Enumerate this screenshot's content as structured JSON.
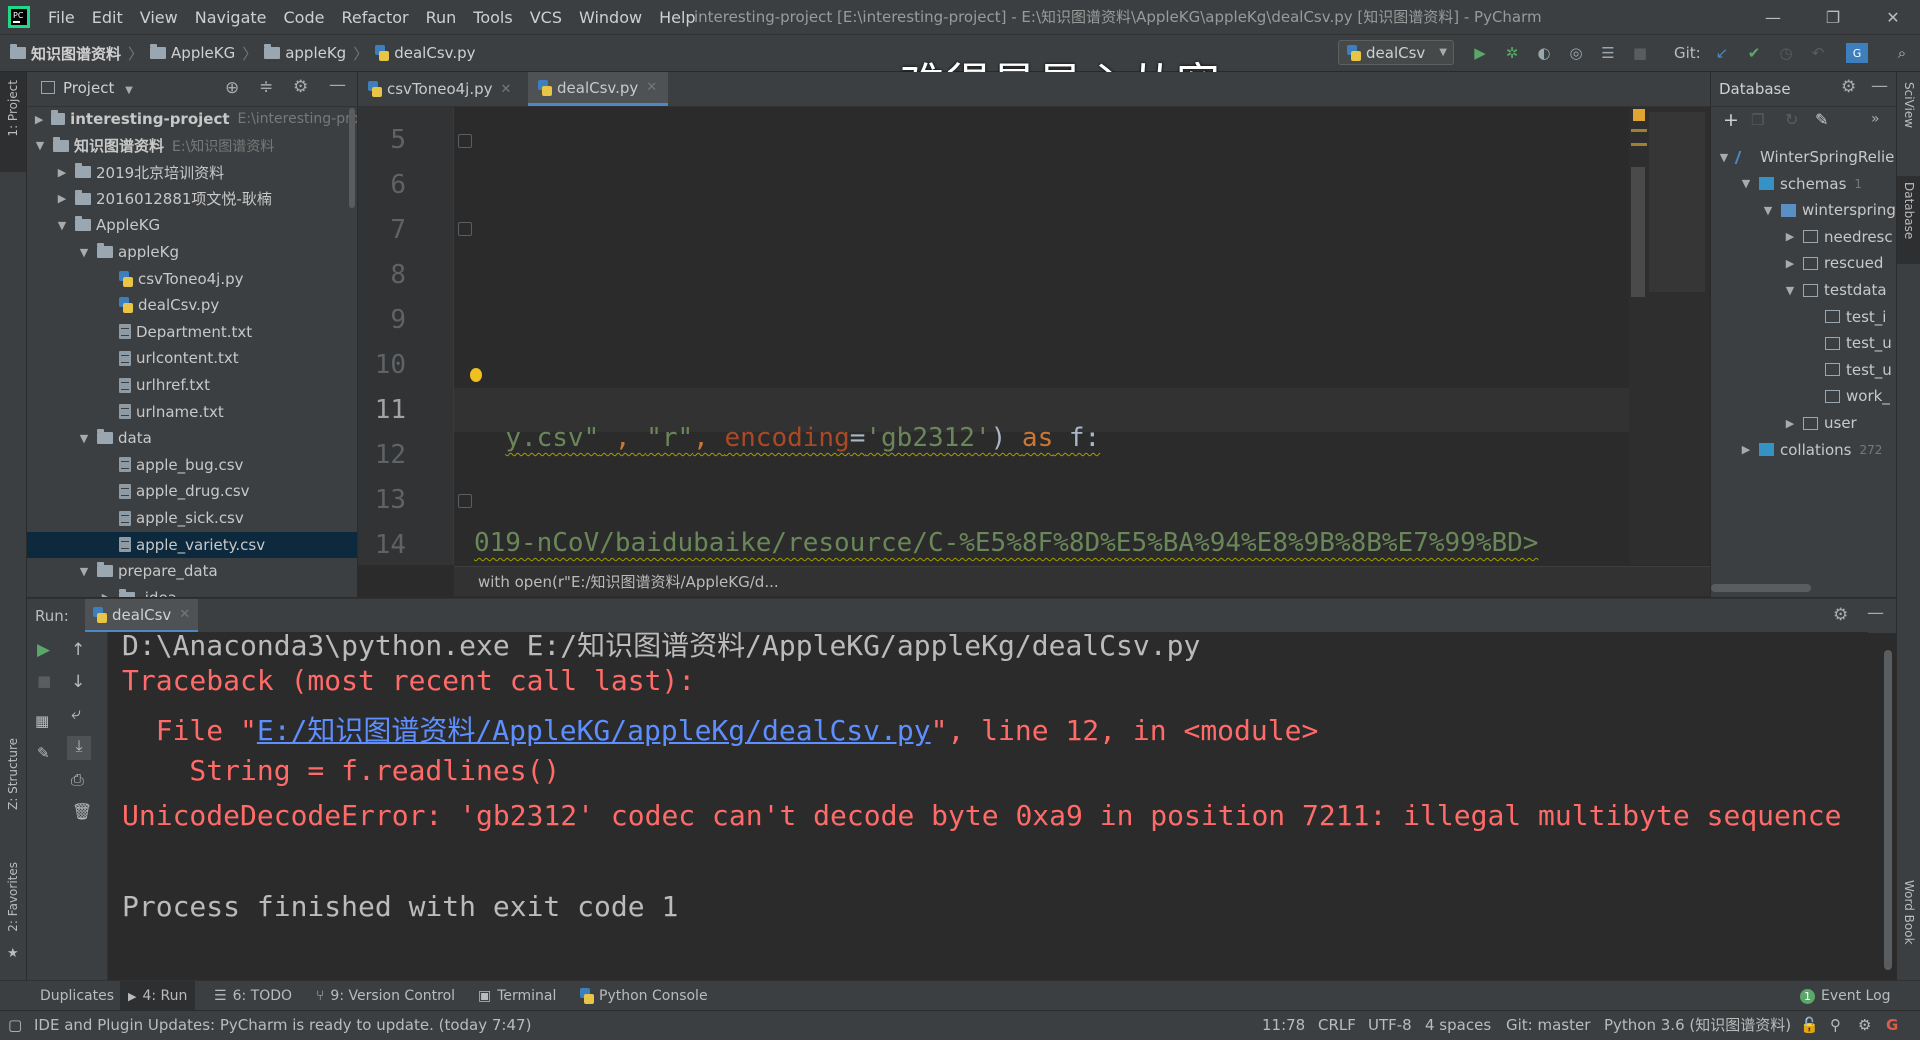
{
  "menubar": {
    "items": [
      "File",
      "Edit",
      "View",
      "Navigate",
      "Code",
      "Refactor",
      "Run",
      "Tools",
      "VCS",
      "Window",
      "Help"
    ],
    "window_title": "interesting-project [E:\\interesting-project] - E:\\知识图谱资料\\AppleKG\\appleKg\\dealCsv.py [知识图谱资料] - PyCharm"
  },
  "navbar": {
    "crumbs": [
      "知识图谱资料",
      "AppleKG",
      "appleKg",
      "dealCsv.py"
    ],
    "run_config": "dealCsv",
    "git_label": "Git:"
  },
  "caption": "难得最是心从容",
  "left_strip": {
    "project": "1: Project",
    "structure": "Z: Structure",
    "favorites": "2: Favorites"
  },
  "right_strip": {
    "sciview": "SciView",
    "database": "Database",
    "wordbook": "Word Book"
  },
  "project_panel": {
    "title": "Project",
    "tree": [
      {
        "label": "interesting-project",
        "extra": "E:\\interesting-proj",
        "type": "folder",
        "expanded": false,
        "bold": true
      },
      {
        "label": "知识图谱资料",
        "extra": "E:\\知识图谱资料",
        "type": "folder",
        "expanded": true,
        "bold": true
      },
      {
        "label": "2019北京培训资料",
        "extra": "",
        "type": "folder",
        "expanded": false
      },
      {
        "label": "2016012881项文悦-耿楠",
        "extra": "",
        "type": "folder",
        "expanded": false
      },
      {
        "label": "AppleKG",
        "extra": "",
        "type": "folder",
        "expanded": true
      },
      {
        "label": "appleKg",
        "extra": "",
        "type": "folder",
        "expanded": true
      },
      {
        "label": "csvToneo4j.py",
        "extra": "",
        "type": "py"
      },
      {
        "label": "dealCsv.py",
        "extra": "",
        "type": "py"
      },
      {
        "label": "Department.txt",
        "extra": "",
        "type": "txt"
      },
      {
        "label": "urlcontent.txt",
        "extra": "",
        "type": "txt"
      },
      {
        "label": "urlhref.txt",
        "extra": "",
        "type": "txt"
      },
      {
        "label": "urlname.txt",
        "extra": "",
        "type": "txt"
      },
      {
        "label": "data",
        "extra": "",
        "type": "folder",
        "expanded": true
      },
      {
        "label": "apple_bug.csv",
        "extra": "",
        "type": "txt"
      },
      {
        "label": "apple_drug.csv",
        "extra": "",
        "type": "txt"
      },
      {
        "label": "apple_sick.csv",
        "extra": "",
        "type": "txt"
      },
      {
        "label": "apple_variety.csv",
        "extra": "",
        "type": "txt",
        "selected": true
      },
      {
        "label": "prepare_data",
        "extra": "",
        "type": "folder",
        "expanded": true
      },
      {
        "label": ".idea",
        "extra": "",
        "type": "folder",
        "expanded": false
      }
    ]
  },
  "editor": {
    "tabs": [
      {
        "label": "csvToneo4j.py",
        "active": false
      },
      {
        "label": "dealCsv.py",
        "active": true
      }
    ],
    "line_numbers": [
      "5",
      "6",
      "7",
      "8",
      "9",
      "10",
      "11",
      "12",
      "13",
      "14"
    ],
    "current_line": "11",
    "line11": {
      "t1": "y.csv\"",
      "t2": " , ",
      "t3": "\"r\"",
      "t4": ", ",
      "t5": "encoding",
      "t6": "=",
      "t7": "'gb2312'",
      "t8": ") ",
      "t9": "as",
      "t10": " f:"
    },
    "line14": "019-nCoV/baidubaike/resource/C-%E5%8F%8D%E5%BA%94%E8%9B%8B%E7%99%BD>",
    "hint": "with open(r\"E:/知识图谱资料/AppleKG/d..."
  },
  "database_panel": {
    "title": "Database",
    "tree": [
      {
        "label": "WinterSpringRelie",
        "count": "",
        "indent": 0,
        "tri": "▼"
      },
      {
        "label": "schemas",
        "count": "1",
        "indent": 1,
        "tri": "▼"
      },
      {
        "label": "winterspring",
        "count": "",
        "indent": 2,
        "tri": "▼"
      },
      {
        "label": "needresc",
        "count": "",
        "indent": 3,
        "tri": "▶"
      },
      {
        "label": "rescued",
        "count": "",
        "indent": 3,
        "tri": "▶"
      },
      {
        "label": "testdata",
        "count": "",
        "indent": 3,
        "tri": "▼"
      },
      {
        "label": "test_i",
        "count": "",
        "indent": 4,
        "tri": ""
      },
      {
        "label": "test_u",
        "count": "",
        "indent": 4,
        "tri": ""
      },
      {
        "label": "test_u",
        "count": "",
        "indent": 4,
        "tri": ""
      },
      {
        "label": "work_",
        "count": "",
        "indent": 4,
        "tri": ""
      },
      {
        "label": "user",
        "count": "",
        "indent": 3,
        "tri": "▶"
      },
      {
        "label": "collations",
        "count": "272",
        "indent": 1,
        "tri": "▶"
      }
    ]
  },
  "run_panel": {
    "label": "Run:",
    "tab": "dealCsv",
    "lines": {
      "cmd": "D:\\Anaconda3\\python.exe E:/知识图谱资料/AppleKG/appleKg/dealCsv.py",
      "traceback": "Traceback (most recent call last):",
      "file_pre": "  File \"",
      "file_link": "E:/知识图谱资料/AppleKG/appleKg/dealCsv.py",
      "file_post": "\", line 12, in <module>",
      "code": "    String = f.readlines()",
      "error": "UnicodeDecodeError: 'gb2312' codec can't decode byte 0xa9 in position 7211: illegal multibyte sequence",
      "exit": "Process finished with exit code 1"
    }
  },
  "bottom_tools": {
    "duplicates": "Duplicates",
    "run": "4: Run",
    "todo": "6: TODO",
    "vcs": "9: Version Control",
    "terminal": "Terminal",
    "python_console": "Python Console",
    "event_log": "Event Log",
    "event_count": "1"
  },
  "status": {
    "message": "IDE and Plugin Updates: PyCharm is ready to update. (today 7:47)",
    "position": "11:78",
    "line_sep": "CRLF",
    "encoding": "UTF-8",
    "indent": "4 spaces",
    "git": "Git: master",
    "interpreter": "Python 3.6 (知识图谱资料)"
  },
  "colors": {
    "background": "#2b2b2b",
    "panel": "#3c3f41",
    "error_red": "#ff6b68",
    "link_blue": "#5e8fff",
    "keyword": "#cc7832",
    "string": "#6a8759",
    "selection": "#0d293e",
    "accent": "#4a88c7"
  }
}
